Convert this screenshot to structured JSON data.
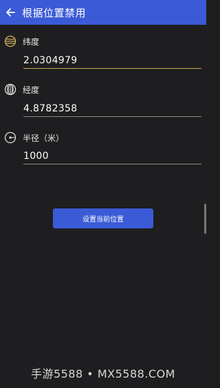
{
  "appbar": {
    "title": "根据位置禁用",
    "back_icon": "arrow-left-icon",
    "color": "#3b5bd6"
  },
  "fields": [
    {
      "label": "纬度",
      "value": "2.0304979",
      "icon": "latitude-globe-icon",
      "focused": true
    },
    {
      "label": "经度",
      "value": "4.8782358",
      "icon": "longitude-globe-icon",
      "focused": false
    },
    {
      "label": "半径（米）",
      "value": "1000",
      "icon": "radius-icon",
      "focused": false
    }
  ],
  "action": {
    "label": "设置当前位置"
  },
  "watermark": {
    "text": "手游5588 • MX5588.COM"
  },
  "colors": {
    "accent": "#3b5bd6",
    "focus_underline": "#c9a94a",
    "background": "#1e1e20"
  }
}
